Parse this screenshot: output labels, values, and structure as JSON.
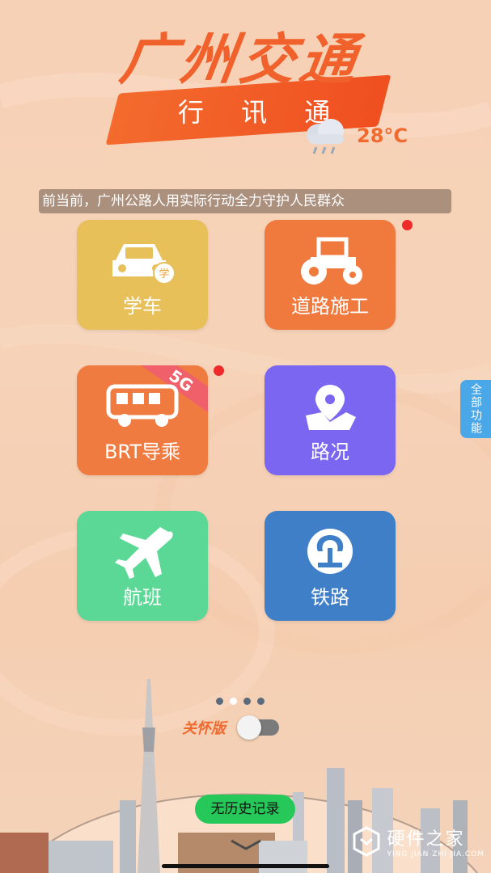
{
  "logo": {
    "title": "广州交通",
    "subtitle": "行 讯 通"
  },
  "weather": {
    "icon": "rain-cloud-icon",
    "temperature": "28°C"
  },
  "marquee": {
    "text": "前当前，广州公路人用实际行动全力守护人民群众"
  },
  "tiles": [
    {
      "label": "学车",
      "icon": "car-icon",
      "color": "#e8c05a"
    },
    {
      "label": "道路施工",
      "icon": "road-roller-icon",
      "color": "#f07a3e"
    },
    {
      "label": "BRT导乘",
      "icon": "bus-icon",
      "color": "#ef7b40",
      "badge": "5G"
    },
    {
      "label": "路况",
      "icon": "map-pin-icon",
      "color": "#7b66f2"
    },
    {
      "label": "航班",
      "icon": "airplane-icon",
      "color": "#5cd896"
    },
    {
      "label": "铁路",
      "icon": "railway-icon",
      "color": "#3f7fc8"
    }
  ],
  "car_badge": "学",
  "side_tab": "全部功能",
  "care_mode": {
    "label": "关怀版",
    "enabled": false
  },
  "history_button": "无历史记录",
  "watermark": {
    "title": "硬件之家",
    "subtitle": "YING JIAN ZHI JIA.COM"
  }
}
